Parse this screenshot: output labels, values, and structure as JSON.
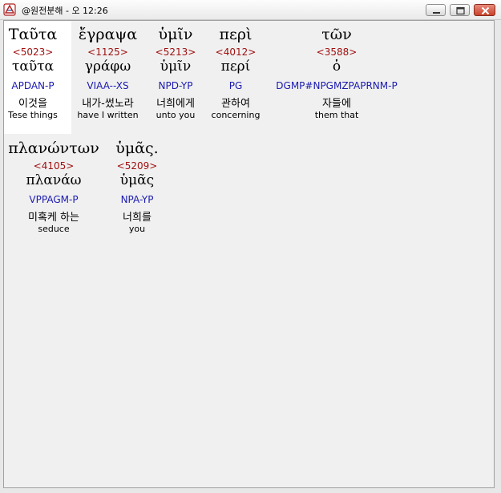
{
  "window": {
    "title": "@원전분해 - 오 12:26",
    "minimize_label": "minimize",
    "maximize_label": "maximize",
    "close_label": "close"
  },
  "icons": {
    "app": "app-logo-icon",
    "minimize": "minimize-icon",
    "maximize": "maximize-icon",
    "close": "close-icon"
  },
  "colors": {
    "strong_number": "#a01010",
    "parsing_code": "#1a1ab0",
    "client_background": "#f0f0f0",
    "close_button": "#c8432b"
  },
  "words": [
    {
      "greek": "Ταῦτα",
      "strong": "<5023>",
      "lemma": "ταῦτα",
      "parse": "APDAN-P",
      "korean": "이것을",
      "english": "Tese things"
    },
    {
      "greek": "ἔγραψα",
      "strong": "<1125>",
      "lemma": "γράφω",
      "parse": "VIAA--XS",
      "korean": "내가-썼노라",
      "english": "have I written"
    },
    {
      "greek": "ὑμῖν",
      "strong": "<5213>",
      "lemma": "ὑμῖν",
      "parse": "NPD-YP",
      "korean": "너희에게",
      "english": "unto you"
    },
    {
      "greek": "περὶ",
      "strong": "<4012>",
      "lemma": "περί",
      "parse": "PG",
      "korean": "관하여",
      "english": "concerning"
    },
    {
      "greek": "τῶν",
      "strong": "<3588>",
      "lemma": "ὁ",
      "parse": "DGMP#NPGMZPAPRNM-P",
      "korean": "자들에",
      "english": "them that"
    },
    {
      "greek": "πλανώντων",
      "strong": "<4105>",
      "lemma": "πλανάω",
      "parse": "VPPAGM-P",
      "korean": "미혹케 하는",
      "english": "seduce"
    },
    {
      "greek": "ὑμᾶς.",
      "strong": "<5209>",
      "lemma": "ὑμᾶς",
      "parse": "NPA-YP",
      "korean": "너희를",
      "english": "you"
    }
  ]
}
